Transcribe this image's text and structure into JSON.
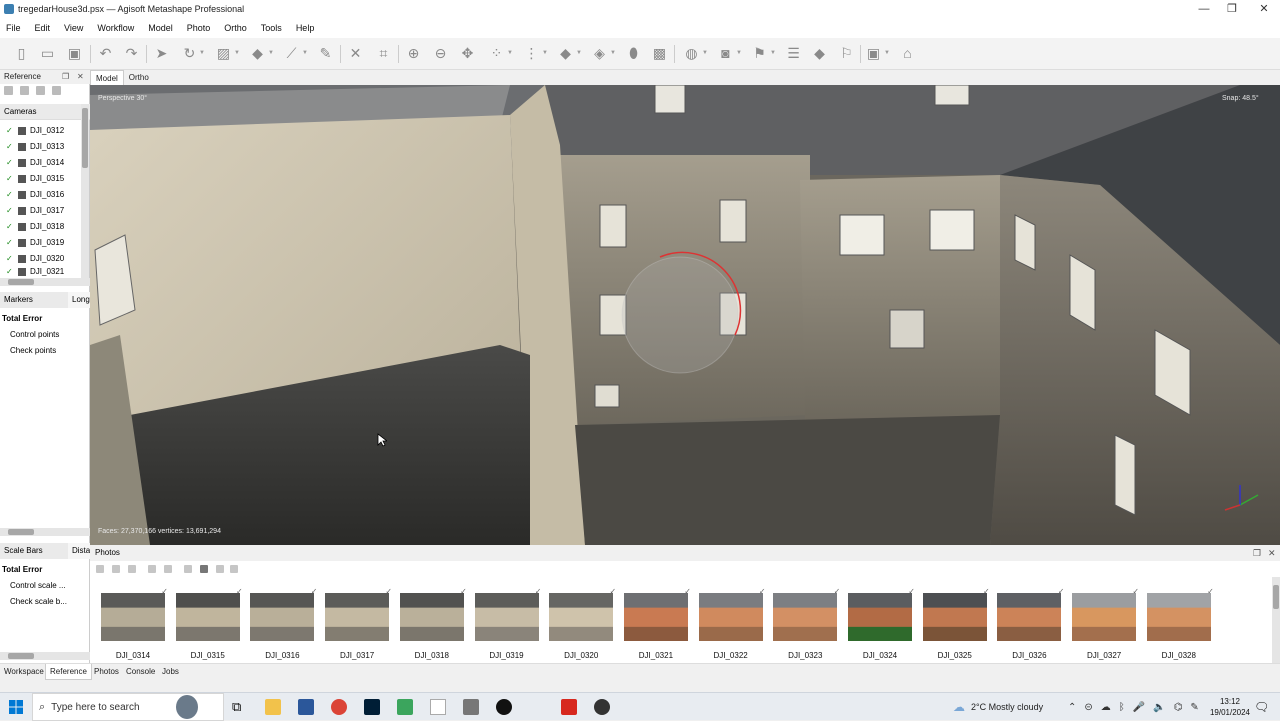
{
  "window": {
    "title": "tregedarHouse3d.psx — Agisoft Metashape Professional",
    "controls": [
      "—",
      "❐",
      "✕"
    ]
  },
  "menu": [
    "File",
    "Edit",
    "View",
    "Workflow",
    "Model",
    "Photo",
    "Ortho",
    "Tools",
    "Help"
  ],
  "toolbar_icons": [
    "new-icon",
    "open-icon",
    "save-icon",
    "undo-icon",
    "redo-icon",
    "select-icon",
    "rotate-icon",
    "rect-select-icon",
    "lasso-icon",
    "ruler-icon",
    "eraser-icon",
    "delete-icon",
    "crop-icon",
    "zoom-in-icon",
    "zoom-out-icon",
    "move-icon",
    "grid-icon",
    "dots-icon",
    "shape-icon",
    "polygon-icon",
    "brush-icon",
    "paint-icon",
    "globe-icon",
    "camera-icon",
    "marker-icon",
    "list-icon",
    "shield-icon",
    "flag-icon",
    "image-icon",
    "hat-icon"
  ],
  "reference_panel": {
    "title": "Reference",
    "cameras_header": "Cameras",
    "cameras": [
      "DJI_0312",
      "DJI_0313",
      "DJI_0314",
      "DJI_0315",
      "DJI_0316",
      "DJI_0317",
      "DJI_0318",
      "DJI_0319",
      "DJI_0320",
      "DJI_0321"
    ],
    "markers_tab": "Markers",
    "longitude_tab": "Long",
    "markers_error_title": "Total Error",
    "markers_items": [
      "Control points",
      "Check points"
    ],
    "scalebars_tab": "Scale Bars",
    "distance_tab": "Dista",
    "scalebars_error_title": "Total Error",
    "scalebars_items": [
      "Control scale ...",
      "Check scale b..."
    ]
  },
  "view_tabs": [
    "Model",
    "Ortho"
  ],
  "viewport": {
    "projection": "Perspective 30°",
    "snap": "Snap: 48.5°",
    "stats": "Faces: 27,370,166 vertices: 13,691,294"
  },
  "photos_pane": {
    "title": "Photos",
    "items": [
      "DJI_0314",
      "DJI_0315",
      "DJI_0316",
      "DJI_0317",
      "DJI_0318",
      "DJI_0319",
      "DJI_0320",
      "DJI_0321",
      "DJI_0322",
      "DJI_0323",
      "DJI_0324",
      "DJI_0325",
      "DJI_0326",
      "DJI_0327",
      "DJI_0328"
    ]
  },
  "bottom_tabs": [
    "Workspace",
    "Reference",
    "Photos",
    "Console",
    "Jobs"
  ],
  "taskbar": {
    "search_placeholder": "Type here to search",
    "weather": "2°C  Mostly cloudy",
    "time": "13:12",
    "date": "19/01/2024"
  }
}
